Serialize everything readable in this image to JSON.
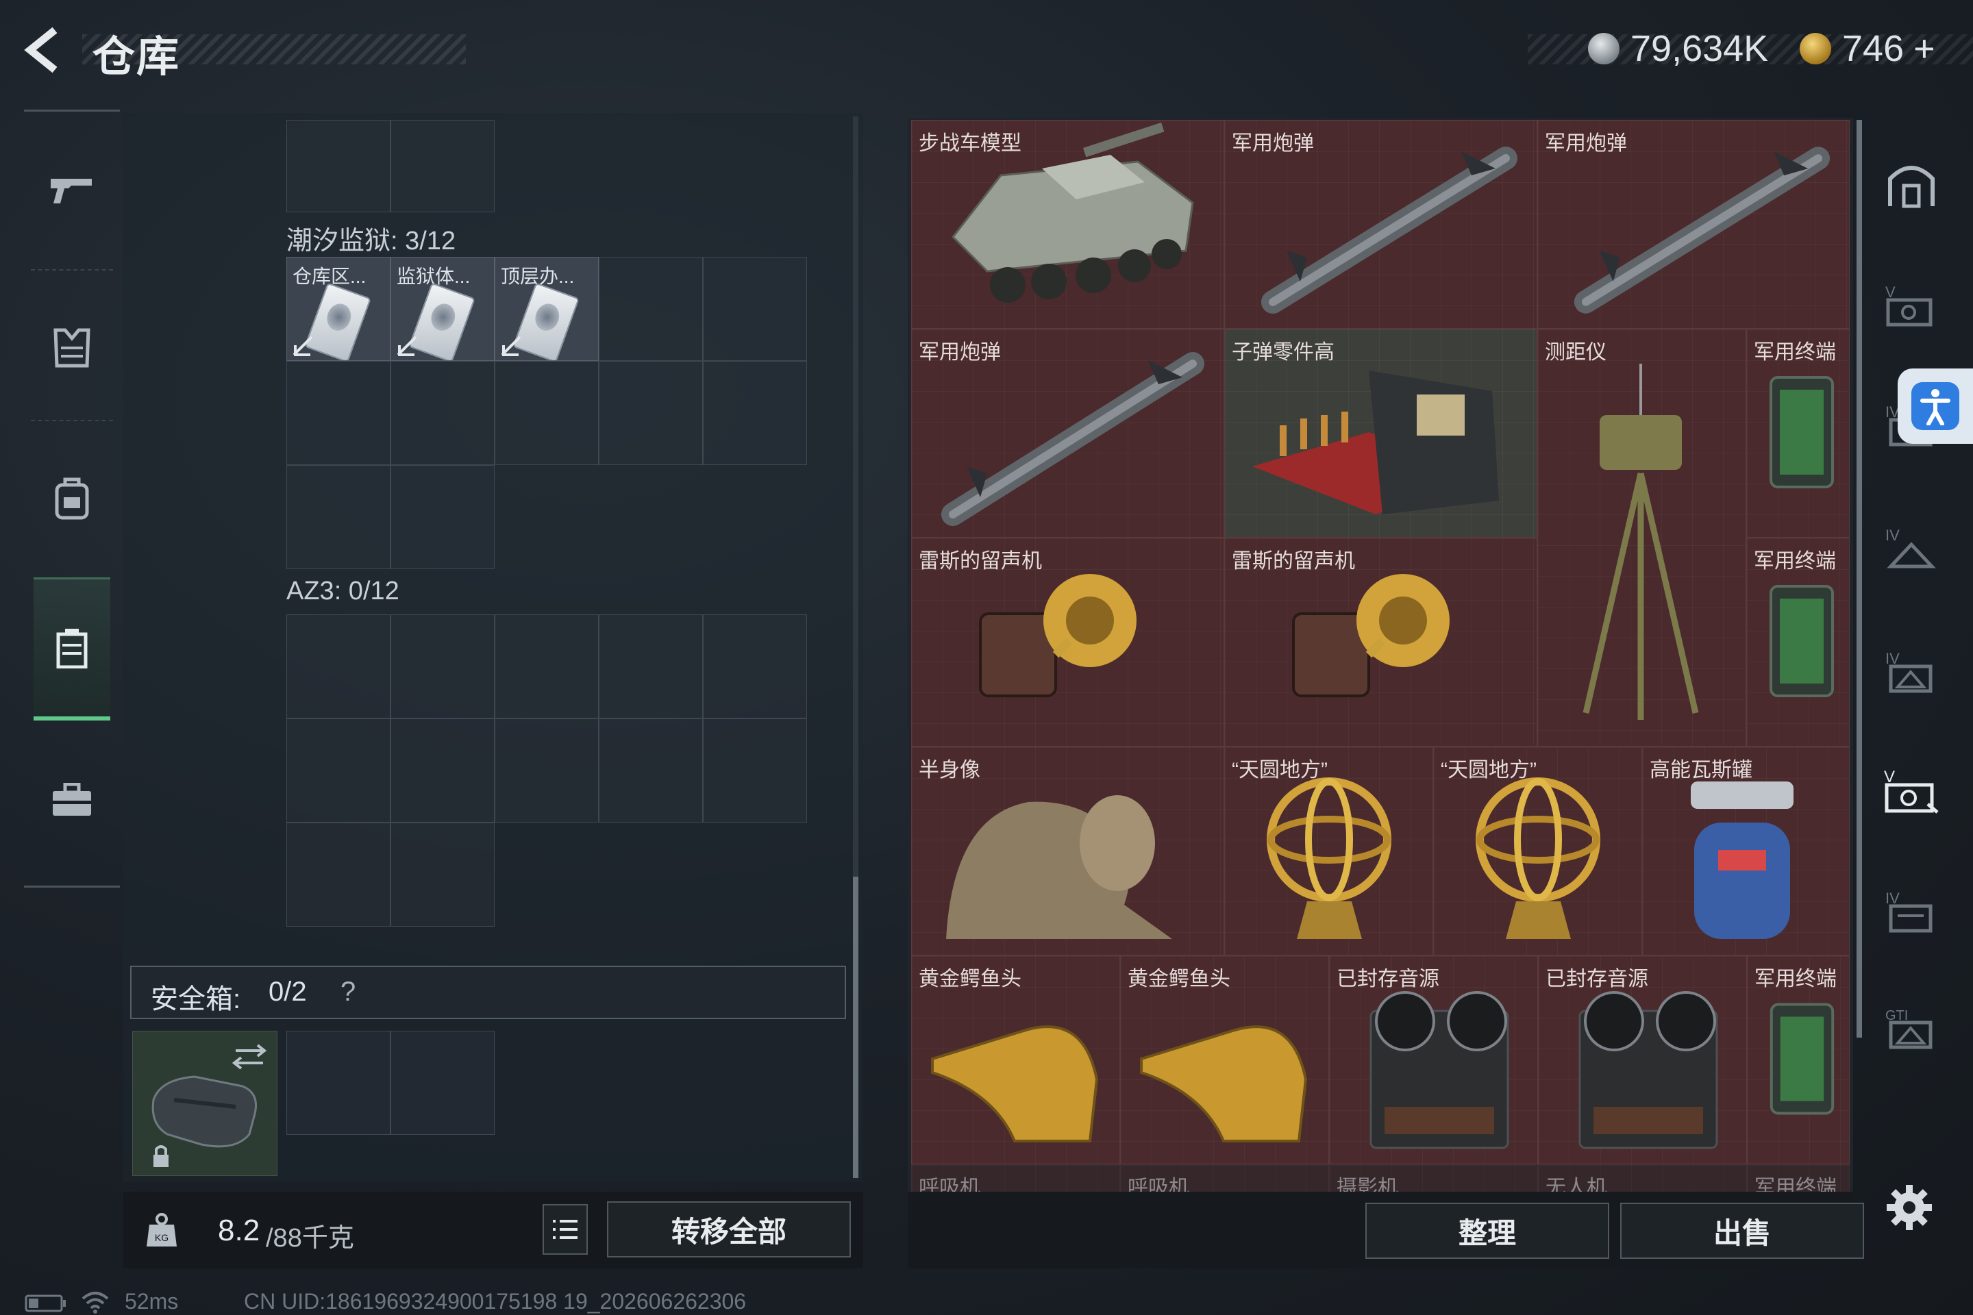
{
  "header": {
    "title": "仓库"
  },
  "currency": {
    "coins": "79,634K",
    "premium": "746",
    "premium_plus": "+"
  },
  "sidebar": {
    "items": [
      "gun-icon",
      "armor-icon",
      "backpack-icon",
      "container-icon",
      "briefcase-icon"
    ],
    "active_index": 3
  },
  "left": {
    "tidal_label": "潮汐监狱: 3/12",
    "keys": [
      {
        "label": "仓库区..."
      },
      {
        "label": "监狱体..."
      },
      {
        "label": "顶层办..."
      }
    ],
    "az3_label": "AZ3: 0/12",
    "safebox": {
      "label": "安全箱:",
      "count": "0/2",
      "help": "?"
    },
    "weight": {
      "value": "8.2",
      "max": "/88千克"
    },
    "transfer_all": "转移全部"
  },
  "items": [
    {
      "name": "步战车模型"
    },
    {
      "name": "军用炮弹"
    },
    {
      "name": "军用炮弹"
    },
    {
      "name": "军用炮弹"
    },
    {
      "name": "子弹零件高"
    },
    {
      "name": "测距仪"
    },
    {
      "name": "军用终端"
    },
    {
      "name": "雷斯的留声机"
    },
    {
      "name": "雷斯的留声机"
    },
    {
      "name": "军用终端"
    },
    {
      "name": "半身像"
    },
    {
      "name": "“天圆地方”"
    },
    {
      "name": "“天圆地方”"
    },
    {
      "name": "高能瓦斯罐"
    },
    {
      "name": "黄金鳄鱼头"
    },
    {
      "name": "黄金鳄鱼头"
    },
    {
      "name": "已封存音源"
    },
    {
      "name": "已封存音源"
    },
    {
      "name": "军用终端"
    },
    {
      "name": "呼吸机"
    },
    {
      "name": "呼吸机"
    },
    {
      "name": "摄影机"
    },
    {
      "name": "无人机"
    },
    {
      "name": "军用终端"
    }
  ],
  "right_actions": {
    "organize": "整理",
    "sell": "出售"
  },
  "right_sidebar": {
    "items": [
      "safehouse-icon",
      "tier-v-icon",
      "tier-iv-icon",
      "tier-iv-icon",
      "tier-iv-icon",
      "tier-v-icon",
      "tier-iv-icon",
      "gti-icon"
    ]
  },
  "status": {
    "ping": "52ms",
    "uid": "CN UID:1861969324900175198 19_202606262306"
  },
  "colors": {
    "accent_green": "#5fc98c",
    "item_bg": "#4a2a2c",
    "gold": "#d1a33a"
  }
}
